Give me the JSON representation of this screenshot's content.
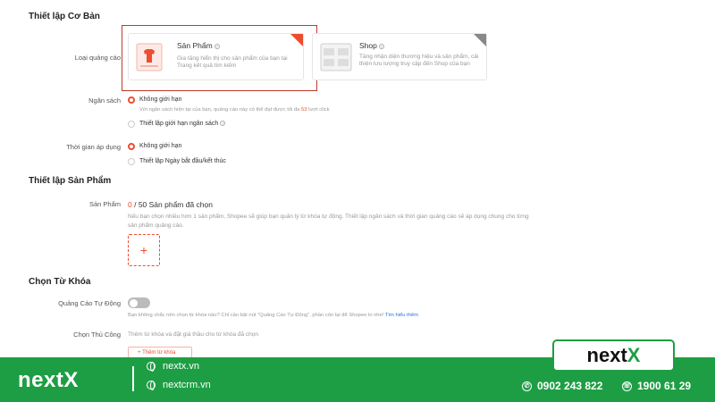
{
  "basic": {
    "title": "Thiết lập Cơ Bản",
    "ad_type_label": "Loại quảng cáo",
    "product_card": {
      "title": "Sản Phẩm",
      "desc": "Gia tăng hiển thị cho sản phẩm của bạn tại Trang kết quả tìm kiếm"
    },
    "shop_card": {
      "title": "Shop",
      "desc": "Tăng nhận diện thương hiệu và sản phẩm, cải thiện lưu lượng truy cập đến Shop của bạn"
    },
    "budget_label": "Ngân sách",
    "budget_opt1": "Không giới hạn",
    "budget_hint_pre": "Với ngân sách hiện tại của bạn, quảng cáo này có thể đạt được tối đa ",
    "budget_hint_num": "53",
    "budget_hint_post": " lượt click",
    "budget_opt2": "Thiết lập giới hạn ngân sách",
    "time_label": "Thời gian áp dụng",
    "time_opt1": "Không giới hạn",
    "time_opt2": "Thiết lập Ngày bắt đầu/kết thúc"
  },
  "products": {
    "title": "Thiết lập Sản Phẩm",
    "label": "Sản Phẩm",
    "count": "0",
    "count_text": " / 50 Sản phẩm đã chọn",
    "hint_line1": "Nếu bạn chọn nhiều hơn 1 sản phẩm, Shopee sẽ giúp bạn quản lý từ khóa tự động. Thiết lập ngân sách và thời gian quảng cáo sẽ áp dụng chung cho từng",
    "hint_line2": "sản phẩm quảng cáo.",
    "add_symbol": "+"
  },
  "keywords": {
    "title": "Chọn Từ Khóa",
    "auto_label": "Quảng Cáo Tự Động",
    "auto_hint": "Bạn không chắc nên chọn từ khóa nào? Chỉ cần bật nút \"Quảng Cáo Tự Động\", phần còn lại để Shopee lo nhé! ",
    "auto_link": "Tìm hiểu thêm",
    "manual_label": "Chọn Thủ Công",
    "manual_hint": "Thêm từ khóa và đặt giá thầu cho từ khóa đã chọn",
    "add_kw_button": "+ Thêm từ khóa"
  },
  "footer": {
    "brand": "nextX",
    "web1": "nextx.vn",
    "web2": "nextcrm.vn",
    "phone1": "0902 243 822",
    "phone2": "1900 61 29",
    "logo_main": "next",
    "logo_x": "X"
  },
  "colors": {
    "accent": "#ee4d2d",
    "footer_green": "#1e9e44",
    "highlight": "#c0392b"
  }
}
